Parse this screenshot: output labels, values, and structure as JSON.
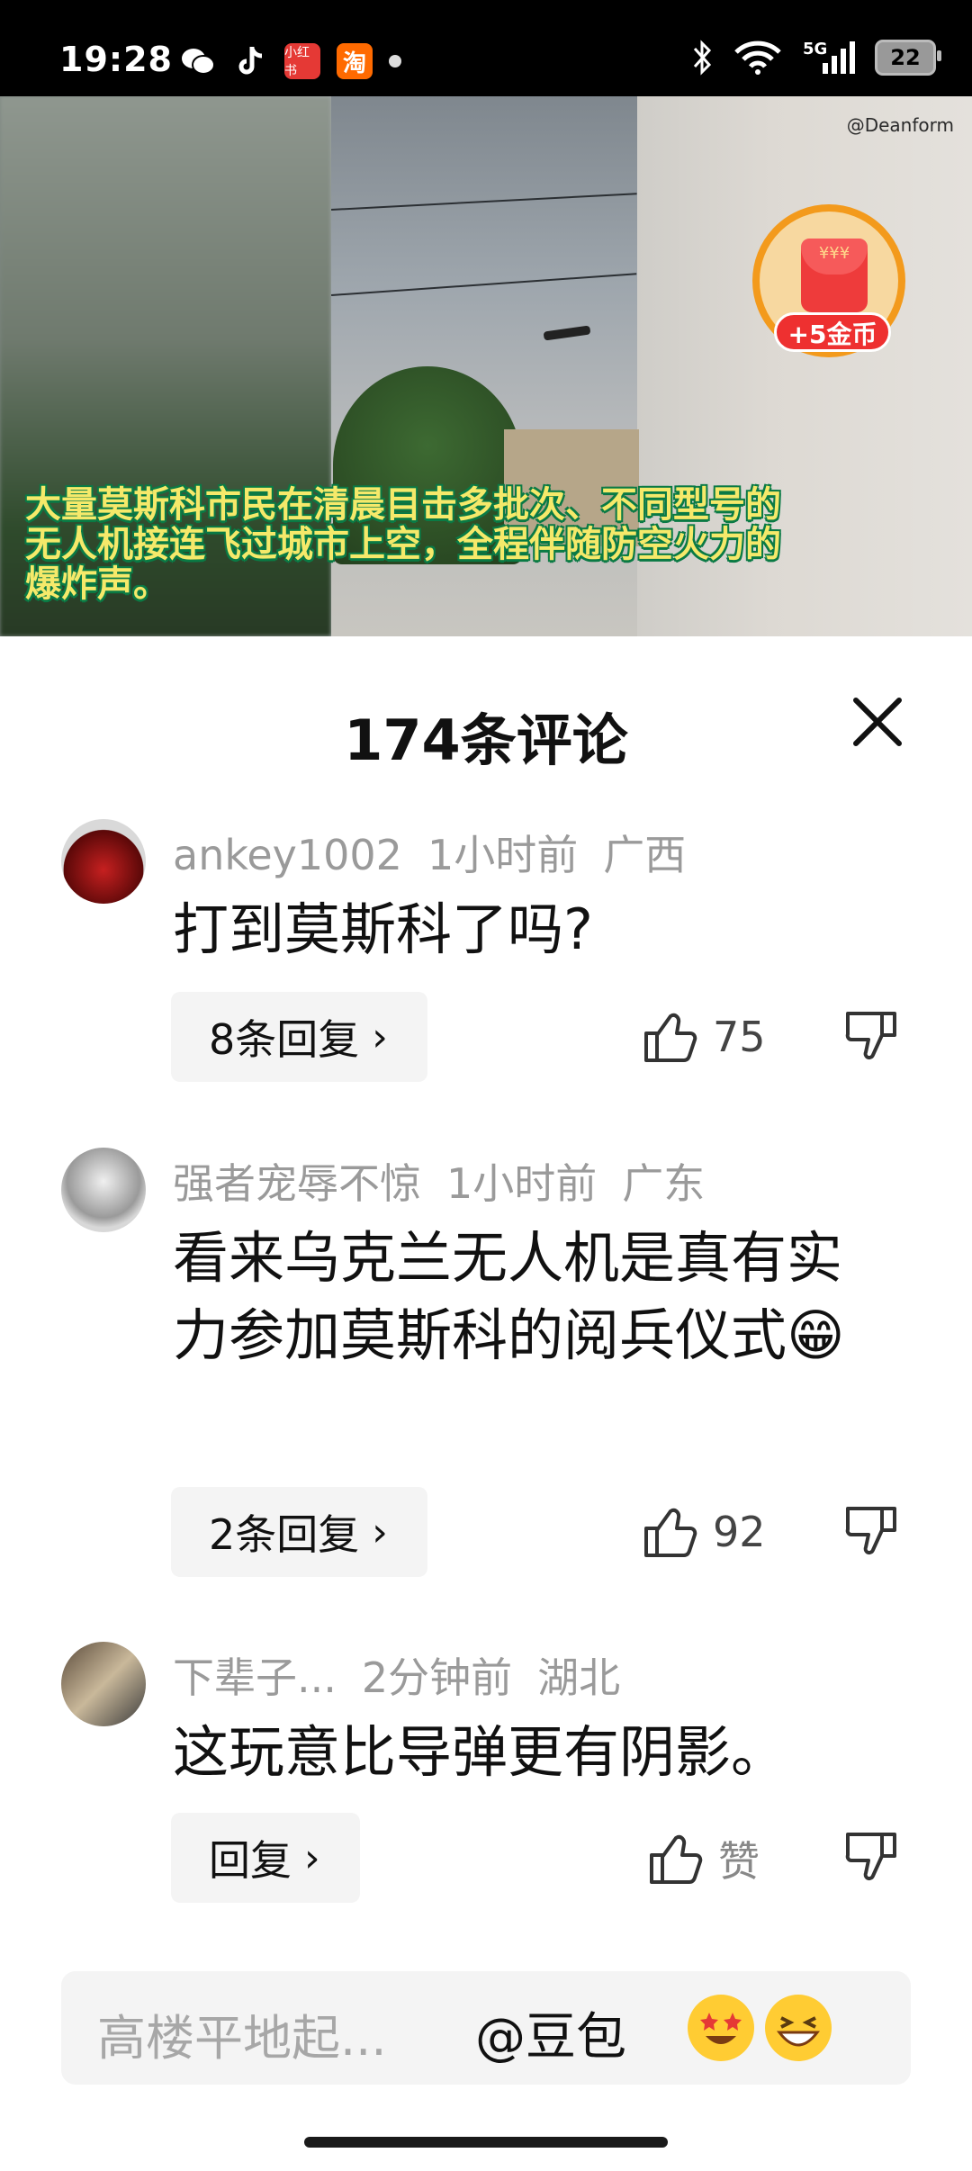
{
  "status_bar": {
    "time": "19:28",
    "app_icons": [
      "wechat-icon",
      "tiktok-icon",
      "xiaohongshu-icon",
      "taobao-icon"
    ],
    "app_icon_labels": {
      "xiaohongshu": "小红书",
      "taobao": "淘"
    },
    "network": "5G",
    "battery": "22"
  },
  "video": {
    "watermark": "@Deanform",
    "caption": "大量莫斯科市民在清晨目击多批次、不同型号的无人机接连飞过城市上空，全程伴随防空火力的爆炸声。",
    "coin_badge": {
      "label": "+5金币",
      "pack_text": "¥¥¥"
    }
  },
  "comments_panel": {
    "title": "174条评论",
    "comments": [
      {
        "user": "ankey1002",
        "time": "1小时前",
        "location": "广西",
        "text": "打到莫斯科了吗?",
        "reply_label": "8条回复",
        "likes": "75"
      },
      {
        "user": "强者宠辱不惊",
        "time": "1小时前",
        "location": "广东",
        "text": "看来乌克兰无人机是真有实力参加莫斯科的阅兵仪式😁",
        "reply_label": "2条回复",
        "likes": "92"
      },
      {
        "user": "下辈子...",
        "time": "2分钟前",
        "location": "湖北",
        "text": "这玩意比导弹更有阴影。",
        "reply_label": "回复",
        "likes": "赞"
      }
    ]
  },
  "input_bar": {
    "placeholder": "高楼平地起...",
    "mention": "@豆包"
  },
  "colors": {
    "caption_text": "#f5e96a",
    "caption_outline": "#0a7a45",
    "coin_red": "#ee3030",
    "meta_gray": "#9a9a9a"
  }
}
